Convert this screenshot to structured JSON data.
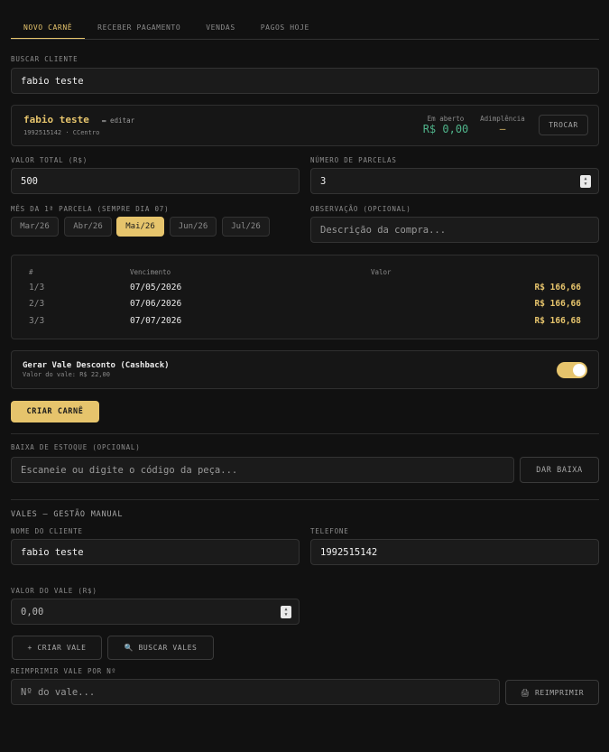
{
  "tabs": [
    {
      "label": "NOVO CARNÊ",
      "active": true
    },
    {
      "label": "RECEBER PAGAMENTO",
      "active": false
    },
    {
      "label": "VENDAS",
      "active": false
    },
    {
      "label": "PAGOS HOJE",
      "active": false
    }
  ],
  "search": {
    "label": "BUSCAR CLIENTE",
    "value": "fabio teste"
  },
  "client": {
    "name": "fabio teste",
    "edit_label": "editar",
    "subline": "1992515142 · CCentro",
    "open_label": "Em aberto",
    "open_value": "R$ 0,00",
    "adimplencia_label": "Adimplência",
    "adimplencia_value": "—",
    "swap_button": "TROCAR"
  },
  "form": {
    "total_label": "VALOR TOTAL (R$)",
    "total_value": "500",
    "installments_label": "NÚMERO DE PARCELAS",
    "installments_value": "3",
    "month_label": "MÊS DA 1ª PARCELA (SEMPRE DIA 07)",
    "months": [
      {
        "label": "Mar/26",
        "active": false
      },
      {
        "label": "Abr/26",
        "active": false
      },
      {
        "label": "Mai/26",
        "active": true
      },
      {
        "label": "Jun/26",
        "active": false
      },
      {
        "label": "Jul/26",
        "active": false
      }
    ],
    "note_label": "OBSERVAÇÃO (OPCIONAL)",
    "note_placeholder": "Descrição da compra..."
  },
  "installments_table": {
    "headers": {
      "index": "#",
      "due": "Vencimento",
      "value": "Valor"
    },
    "rows": [
      {
        "index": "1/3",
        "due": "07/05/2026",
        "value": "R$ 166,66"
      },
      {
        "index": "2/3",
        "due": "07/06/2026",
        "value": "R$ 166,66"
      },
      {
        "index": "3/3",
        "due": "07/07/2026",
        "value": "R$ 166,68"
      }
    ]
  },
  "cashback": {
    "title": "Gerar Vale Desconto (Cashback)",
    "subtitle": "Valor do vale: R$ 22,00",
    "enabled": true
  },
  "create_button": "CRIAR CARNÊ",
  "stock": {
    "label": "BAIXA DE ESTOQUE (OPCIONAL)",
    "placeholder": "Escaneie ou digite o código da peça...",
    "button": "DAR BAIXA"
  },
  "vouchers": {
    "title": "VALES — GESTÃO MANUAL",
    "client_label": "NOME DO CLIENTE",
    "client_value": "fabio teste",
    "phone_label": "TELEFONE",
    "phone_value": "1992515142",
    "amount_label": "VALOR DO VALE (R$)",
    "amount_value": "0,00",
    "create_button": "+ CRIAR VALE",
    "search_button": "🔍 BUSCAR VALES",
    "reprint_label": "REIMPRIMIR VALE POR Nº",
    "reprint_placeholder": "Nº do vale...",
    "reprint_button": "🖨 REIMPRIMIR"
  },
  "colors": {
    "accent": "#e6c46c",
    "background": "#111111",
    "positive": "#4fb38a"
  }
}
